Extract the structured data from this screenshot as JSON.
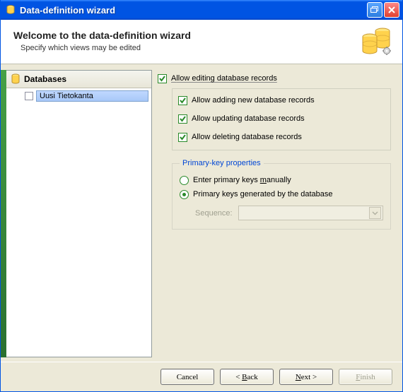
{
  "window": {
    "title": "Data-definition wizard"
  },
  "header": {
    "title": "Welcome to the data-definition wizard",
    "subtitle": "Specify which views may be edited"
  },
  "sidebar": {
    "header": "Databases",
    "items": [
      {
        "label": "Uusi Tietokanta",
        "checked": false
      }
    ]
  },
  "options": {
    "allow_edit": {
      "label_pre": "A",
      "label_post": "llow editing database records",
      "checked": true
    },
    "allow_add": {
      "label": "Allow adding new database records",
      "checked": true
    },
    "allow_update": {
      "label": "Allow updating database records",
      "checked": true
    },
    "allow_delete": {
      "label": "Allow deleting database records",
      "checked": true
    }
  },
  "pk": {
    "legend": "Primary-key properties",
    "manual": {
      "label_pre": "Enter primary keys ",
      "label_u": "m",
      "label_post": "anually",
      "selected": false
    },
    "generated": {
      "label": "Primary keys generated by the database",
      "selected": true
    },
    "sequence_label": "Sequence:"
  },
  "footer": {
    "cancel": "Cancel",
    "back_pre": "< ",
    "back_u": "B",
    "back_post": "ack",
    "next_pre": "",
    "next_u": "N",
    "next_post": "ext >",
    "finish_u": "F",
    "finish_post": "inish"
  }
}
